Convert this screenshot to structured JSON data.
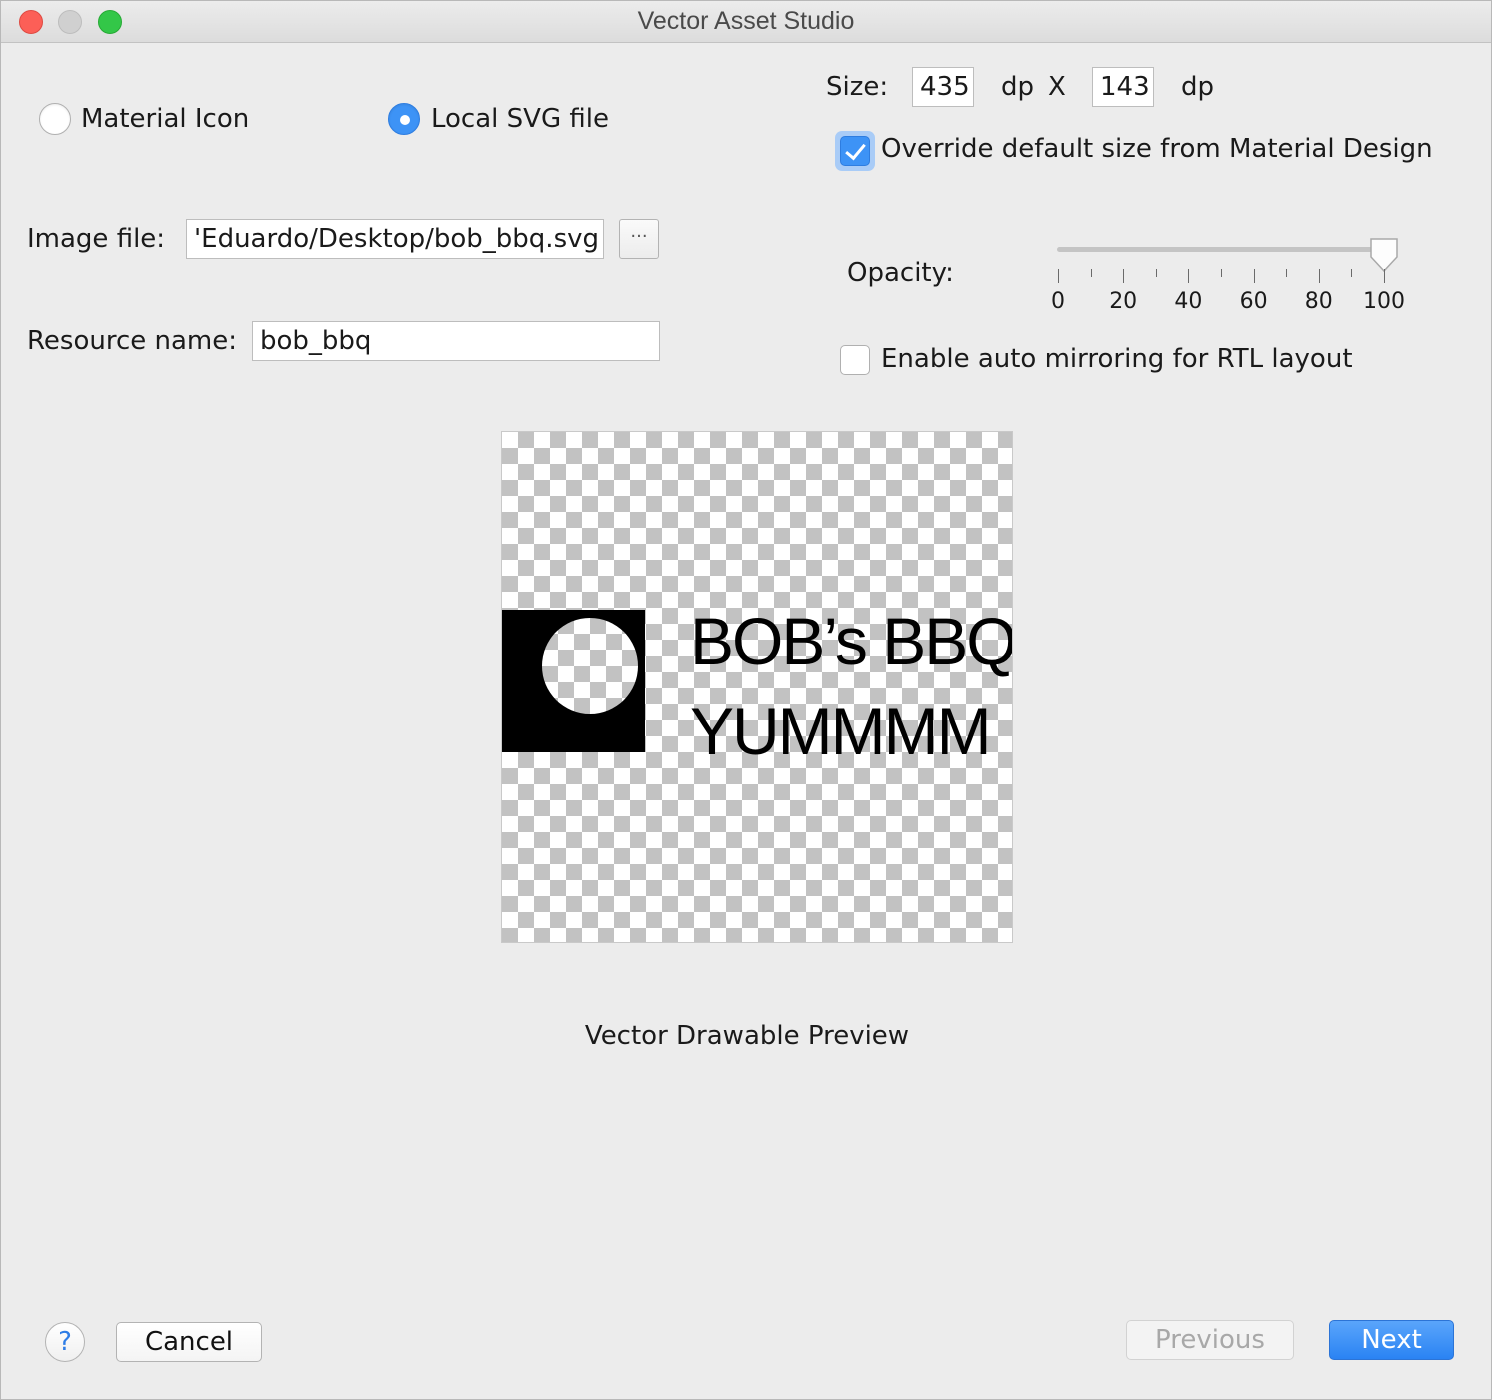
{
  "window": {
    "title": "Vector Asset Studio"
  },
  "asset_type": {
    "material_icon_label": "Material Icon",
    "local_svg_label": "Local SVG file",
    "selected": "Local SVG file"
  },
  "image_file": {
    "label": "Image file:",
    "value": "'Eduardo/Desktop/bob_bbq.svg",
    "browse_label": "···"
  },
  "resource_name": {
    "label": "Resource name:",
    "value": "bob_bbq"
  },
  "size": {
    "label": "Size:",
    "width": "435",
    "width_unit": "dp",
    "separator": "X",
    "height": "143",
    "height_unit": "dp"
  },
  "override": {
    "label": "Override default size from Material Design",
    "checked": true
  },
  "opacity": {
    "label": "Opacity:",
    "value": 100,
    "min": 0,
    "max": 100,
    "tick_labels": [
      "0",
      "20",
      "40",
      "60",
      "80",
      "100"
    ]
  },
  "mirroring": {
    "label": "Enable auto mirroring for RTL layout",
    "checked": false
  },
  "preview": {
    "logo_line1": "BOB’s BBQ",
    "logo_line2": "YUMMMM",
    "caption": "Vector Drawable Preview"
  },
  "footer": {
    "help_label": "?",
    "cancel_label": "Cancel",
    "previous_label": "Previous",
    "next_label": "Next"
  },
  "colors": {
    "accent": "#3d93f6",
    "background": "#ececec"
  }
}
